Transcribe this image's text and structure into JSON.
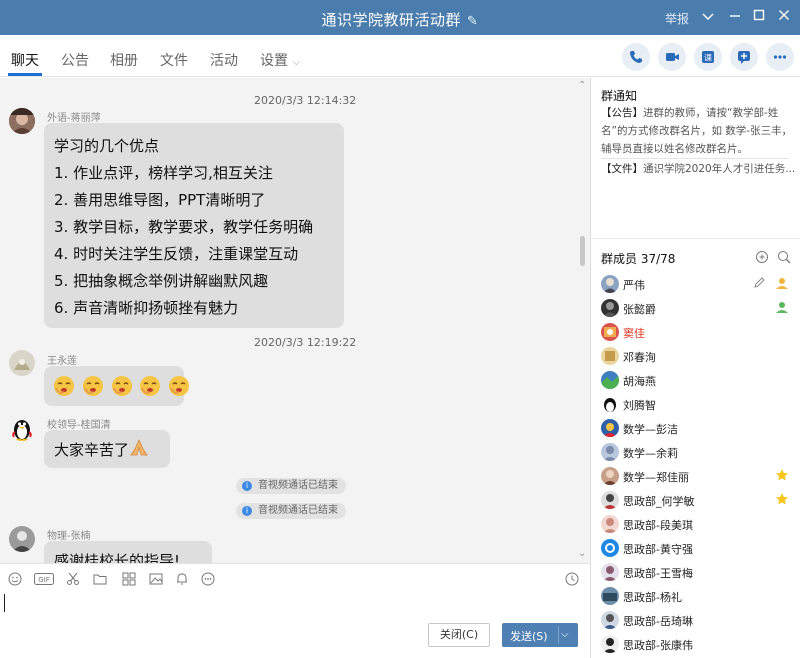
{
  "window": {
    "title": "通识学院教研活动群",
    "report": "举报"
  },
  "tabs": [
    {
      "label": "聊天",
      "active": true
    },
    {
      "label": "公告"
    },
    {
      "label": "相册"
    },
    {
      "label": "文件"
    },
    {
      "label": "活动"
    },
    {
      "label": "设置"
    }
  ],
  "toolbar_icons": [
    "phone-icon",
    "video-icon",
    "classroom-icon",
    "add-app-icon",
    "more-icon"
  ],
  "chat": {
    "messages": [
      {
        "time": "2020/3/3 12:14:32",
        "sender": "外语-蒋丽萍",
        "lines": [
          "学习的几个优点",
          "1. 作业点评，榜样学习,相互关注",
          "2. 善用思维导图，PPT清晰明了",
          "3. 教学目标，教学要求，教学任务明确",
          "4. 时时关注学生反馈，注重课堂互动",
          "5. 把抽象概念举例讲解幽默风趣",
          "6. 声音清晰抑扬顿挫有魅力"
        ]
      },
      {
        "time": "2020/3/3 12:19:22",
        "sender": "王永莲",
        "emoji_count": 5
      },
      {
        "sender": "校领导-桂国清",
        "text": "大家辛苦了"
      },
      {
        "system": "音视频通话已结束"
      },
      {
        "system": "音视频通话已结束"
      },
      {
        "sender": "物理-张楠",
        "text": "感谢桂校长的指导!"
      }
    ]
  },
  "composer": {
    "close_label": "关闭(C)",
    "send_label": "发送(S)"
  },
  "notice": {
    "title": "群通知",
    "announcement_tag": "【公告】",
    "announcement": "进群的教师，请按“教学部-姓名”的方式修改群名片，如 数学-张三丰，辅导员直接以姓名修改群名片。",
    "file_tag": "【文件】",
    "file": "通识学院2020年人才引进任务..."
  },
  "members": {
    "title": "群成员 37/78",
    "list": [
      {
        "name": "严伟",
        "role": "owner"
      },
      {
        "name": "张懿爵",
        "role": "admin"
      },
      {
        "name": "窦佳",
        "highlight": true
      },
      {
        "name": "邓春洵"
      },
      {
        "name": "胡海燕"
      },
      {
        "name": "刘腾智"
      },
      {
        "name": "数学—彭洁"
      },
      {
        "name": "数学—余莉"
      },
      {
        "name": "数学—郑佳丽",
        "star": true
      },
      {
        "name": "思政部_何学敏",
        "star": true
      },
      {
        "name": "思政部-段美琪"
      },
      {
        "name": "思政部-黄守强"
      },
      {
        "name": "思政部-王雪梅"
      },
      {
        "name": "思政部-杨礼"
      },
      {
        "name": "思政部-岳琦琳"
      },
      {
        "name": "思政部-张康伟"
      }
    ]
  },
  "colors": {
    "titlebar": "#4a7dae",
    "bubble": "#dedede",
    "accent": "#1d6fd6",
    "send": "#4e80b3"
  }
}
